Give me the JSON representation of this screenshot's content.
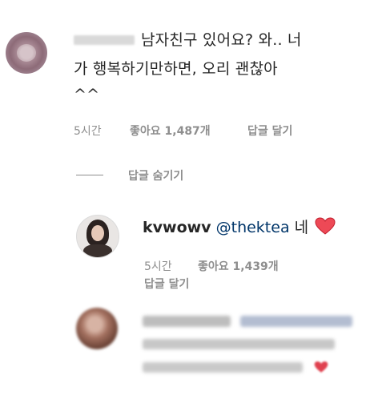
{
  "comment": {
    "text_line1": "남자친구 있어요? 와.. 너",
    "text_line2": "가 행복하기만하면, 오리 괜찮아",
    "text_line3": "^^",
    "time": "5시간",
    "likes": "좋아요 1,487개",
    "reply_button": "답글 달기"
  },
  "replies_toggle": {
    "label": "답글 숨기기"
  },
  "reply": {
    "username": "kvwowv",
    "mention": "@thektea",
    "text": "네",
    "time": "5시간",
    "likes": "좋아요 1,439개",
    "reply_button": "답글 달기"
  },
  "colors": {
    "text": "#262626",
    "meta": "#8e8e8e",
    "mention": "#003569",
    "heart": "#ed4956"
  }
}
